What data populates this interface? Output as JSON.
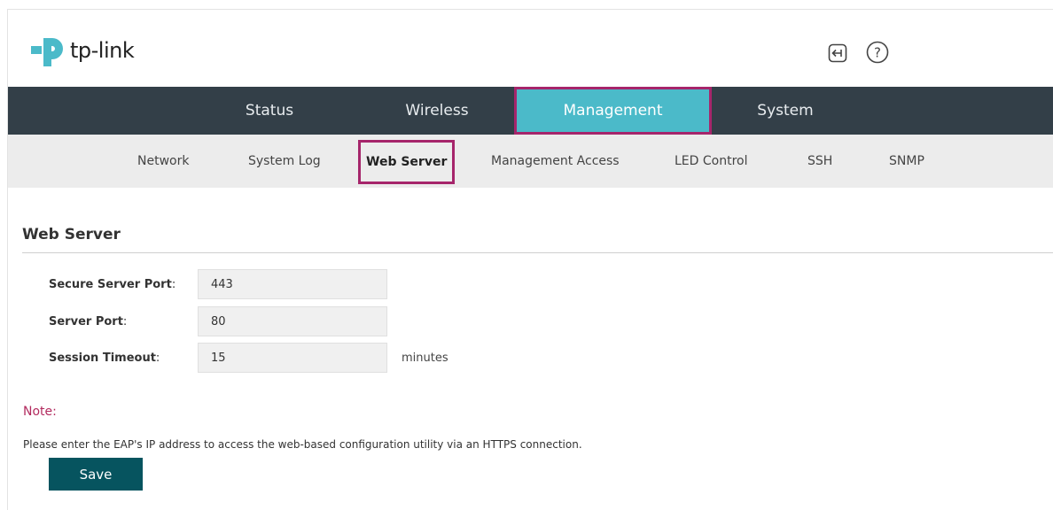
{
  "brand": {
    "logo_text": "tp-link",
    "accent": "#4bbac9",
    "highlight": "#a6256b",
    "nav_bg": "#333f48"
  },
  "header": {
    "logout_icon": "logout-icon",
    "help_icon": "help-icon"
  },
  "main_nav": {
    "tabs": [
      {
        "label": "Status"
      },
      {
        "label": "Wireless"
      },
      {
        "label": "Management",
        "active": true
      },
      {
        "label": "System"
      }
    ]
  },
  "sub_nav": {
    "items": [
      {
        "label": "Network"
      },
      {
        "label": "System Log"
      },
      {
        "label": "Web Server",
        "active": true
      },
      {
        "label": "Management Access"
      },
      {
        "label": "LED Control"
      },
      {
        "label": "SSH"
      },
      {
        "label": "SNMP"
      }
    ]
  },
  "web_server": {
    "title": "Web Server",
    "fields": {
      "secure_port": {
        "label": "Secure Server Port",
        "value": "443"
      },
      "server_port": {
        "label": "Server Port",
        "value": "80"
      },
      "session_timeout": {
        "label": "Session Timeout",
        "value": "15",
        "unit": "minutes"
      }
    },
    "note_title": "Note:",
    "note_text": "Please enter the EAP's IP address to access the web-based configuration utility via an HTTPS connection.",
    "save_label": "Save"
  }
}
